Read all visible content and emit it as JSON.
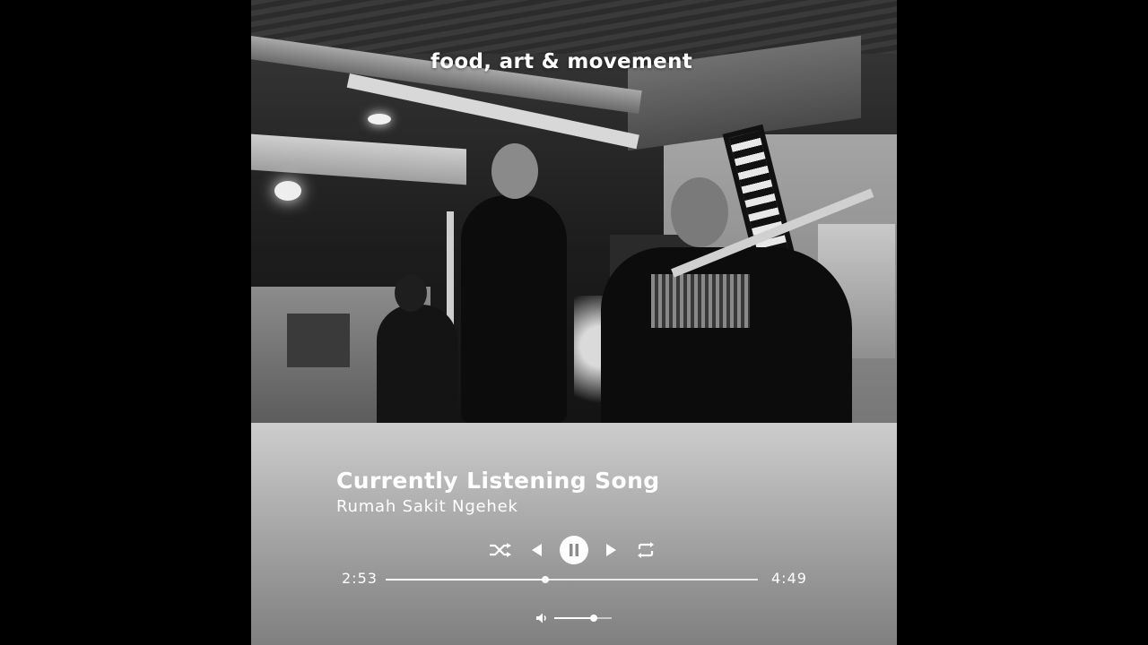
{
  "photo": {
    "caption": "food, art & movement"
  },
  "player": {
    "title": "Currently Listening Song",
    "artist": "Rumah Sakit Ngehek",
    "time_elapsed": "2:53",
    "time_total": "4:49",
    "progress": 0.43,
    "volume": 0.68,
    "is_playing": true,
    "icons": {
      "shuffle": "shuffle-icon",
      "previous": "previous-icon",
      "play_pause": "pause-icon",
      "next": "next-icon",
      "repeat": "repeat-icon",
      "volume": "volume-icon"
    },
    "colors": {
      "text": "#ffffff",
      "panel_top": "#cdcdcd",
      "panel_bottom": "#7f7f7f"
    }
  }
}
